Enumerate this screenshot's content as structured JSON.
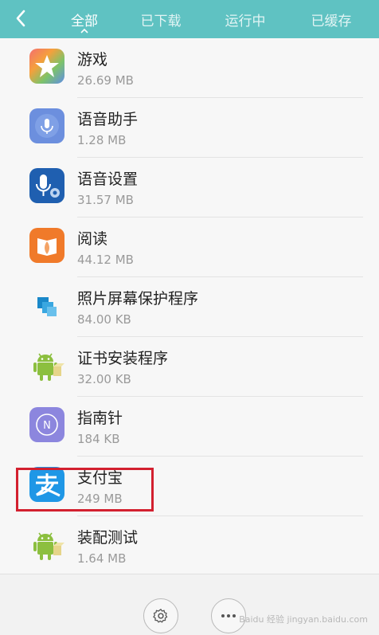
{
  "header": {
    "tabs": [
      {
        "label": "全部",
        "active": true
      },
      {
        "label": "已下载",
        "active": false
      },
      {
        "label": "运行中",
        "active": false
      },
      {
        "label": "已缓存",
        "active": false
      }
    ],
    "bg_color": "#5fc2c2",
    "back_icon": "chevron-left-icon"
  },
  "apps": [
    {
      "name": "游戏",
      "size": "26.69 MB",
      "icon": "game-star-icon"
    },
    {
      "name": "语音助手",
      "size": "1.28 MB",
      "icon": "microphone-icon"
    },
    {
      "name": "语音设置",
      "size": "31.57 MB",
      "icon": "voice-settings-icon"
    },
    {
      "name": "阅读",
      "size": "44.12 MB",
      "icon": "book-icon"
    },
    {
      "name": "照片屏幕保护程序",
      "size": "84.00 KB",
      "icon": "photo-screensaver-icon"
    },
    {
      "name": "证书安装程序",
      "size": "32.00 KB",
      "icon": "android-icon"
    },
    {
      "name": "指南针",
      "size": "184 KB",
      "icon": "compass-icon"
    },
    {
      "name": "支付宝",
      "size": "249 MB",
      "icon": "alipay-icon"
    },
    {
      "name": "装配测试",
      "size": "1.64 MB",
      "icon": "android-icon"
    }
  ],
  "highlight_color": "#d3202f",
  "bottom_bar": {
    "settings_icon": "gear-icon",
    "more_icon": "more-dots-icon"
  },
  "watermark": "Baidu 经验  jingyan.baidu.com"
}
